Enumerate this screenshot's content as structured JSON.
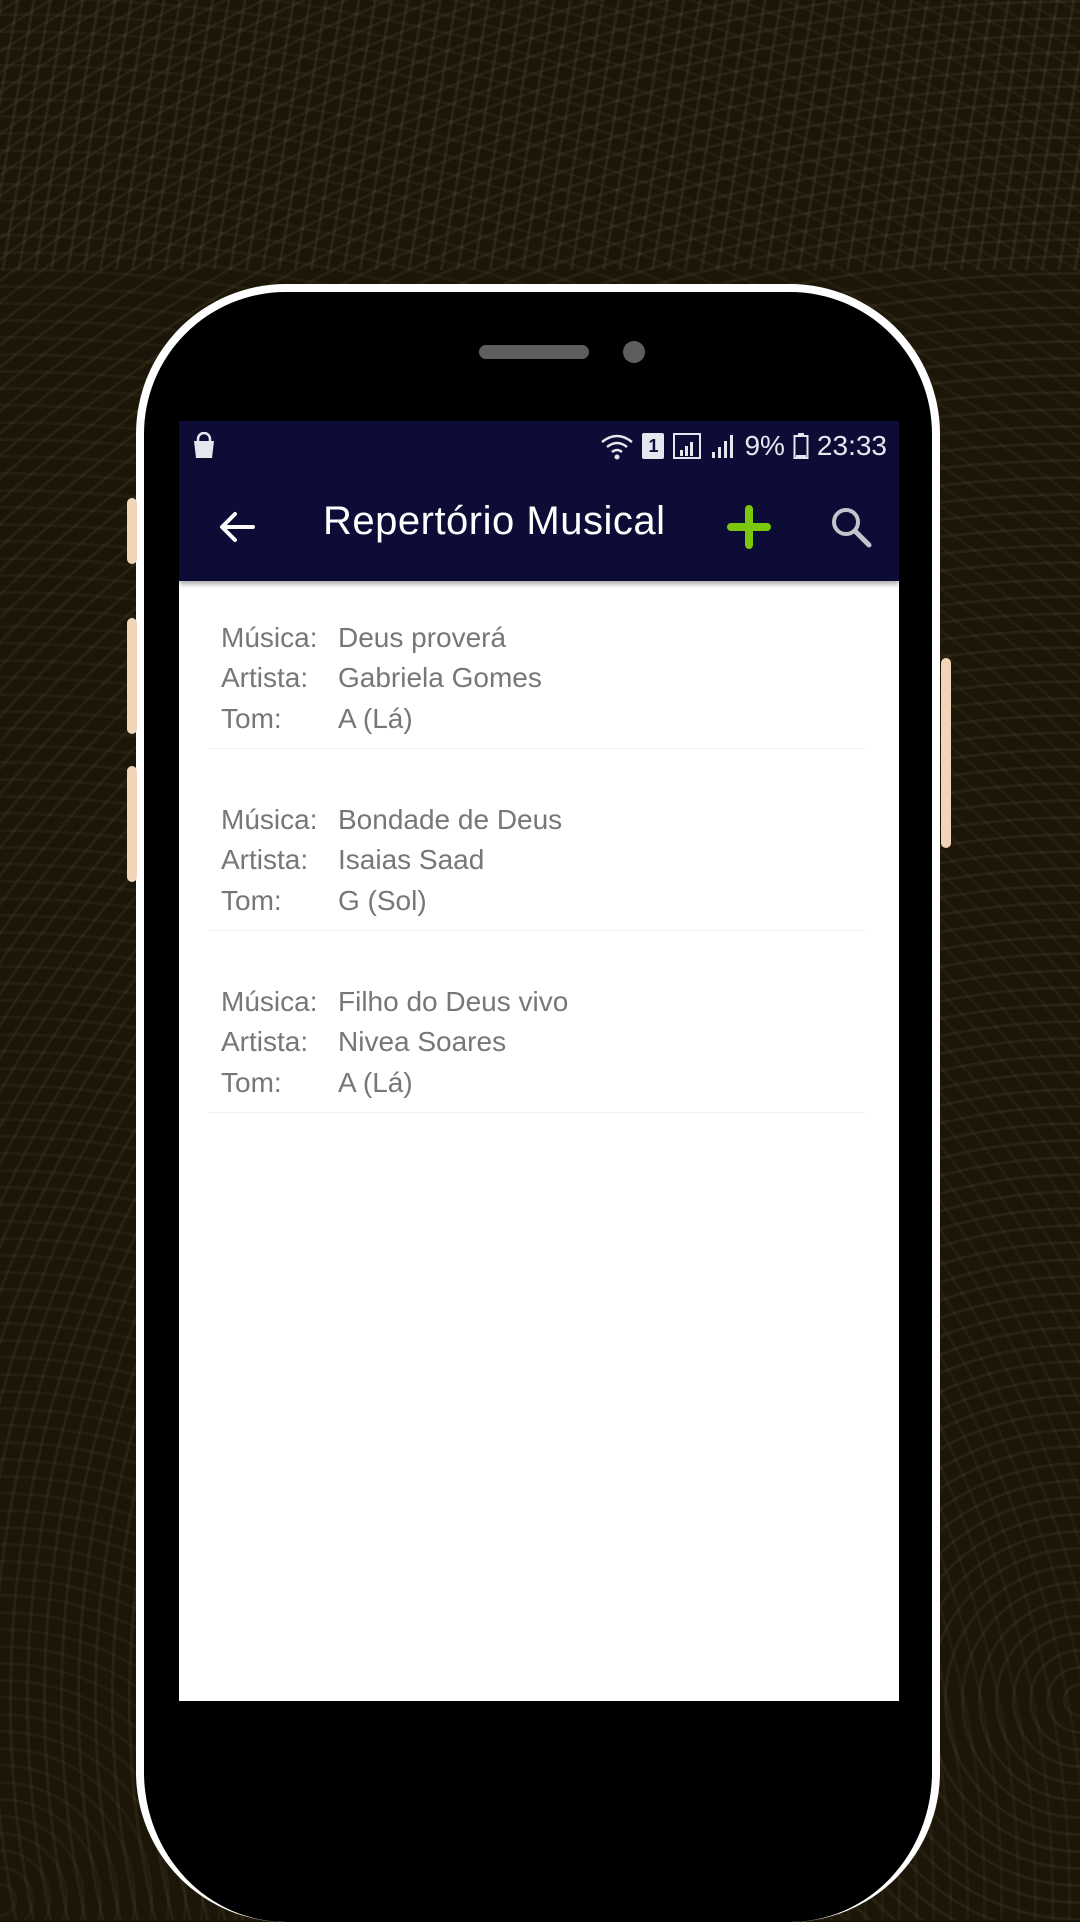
{
  "status_bar": {
    "sim_label": "1",
    "battery": "9%",
    "time": "23:33",
    "icons": [
      "shopping-bag-icon",
      "wifi-icon",
      "sim-icon",
      "signal-icon",
      "signal-icon",
      "battery-icon"
    ]
  },
  "app_bar": {
    "title": "Repertório Musical",
    "back_icon": "arrow-back-icon",
    "add_icon": "plus-icon",
    "search_icon": "search-icon",
    "colors": {
      "background": "#0c0c36",
      "add": "#7ac70c",
      "title": "#ffffff"
    }
  },
  "songs": [
    {
      "music_label": "Música:",
      "music": "Deus proverá",
      "artist_label": "Artista:",
      "artist": "Gabriela Gomes",
      "key_label": "Tom:",
      "key": "A (Lá)"
    },
    {
      "music_label": "Música:",
      "music": "Bondade de Deus",
      "artist_label": "Artista:",
      "artist": "Isaias Saad",
      "key_label": "Tom:",
      "key": "G (Sol)"
    },
    {
      "music_label": "Música:",
      "music": "Filho do Deus vivo",
      "artist_label": "Artista:",
      "artist": "Nivea Soares",
      "key_label": "Tom:",
      "key": "A (Lá)"
    }
  ]
}
